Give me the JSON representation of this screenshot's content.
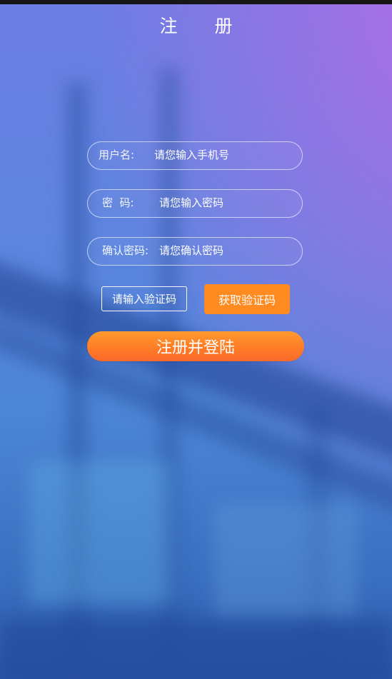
{
  "page": {
    "title": "注 册",
    "background_description_colors": {
      "top_right": "#a86fe0",
      "main": "#5d85df",
      "bottom": "#2c55a8"
    }
  },
  "form": {
    "username": {
      "label": "用户名:",
      "placeholder": "请您输入手机号"
    },
    "password": {
      "label": "密  码:",
      "placeholder": "请您输入密码"
    },
    "confirm_password": {
      "label": "确认密码:",
      "placeholder": "请您确认密码"
    },
    "verification_code": {
      "placeholder": "请输入验证码"
    },
    "get_code_button": "获取验证码",
    "submit_button": "注册并登陆"
  },
  "colors": {
    "accent": "#ff8a1f",
    "submit_gradient_start": "#ff9a2e",
    "submit_gradient_end": "#f96a2c",
    "text": "#ffffff"
  }
}
